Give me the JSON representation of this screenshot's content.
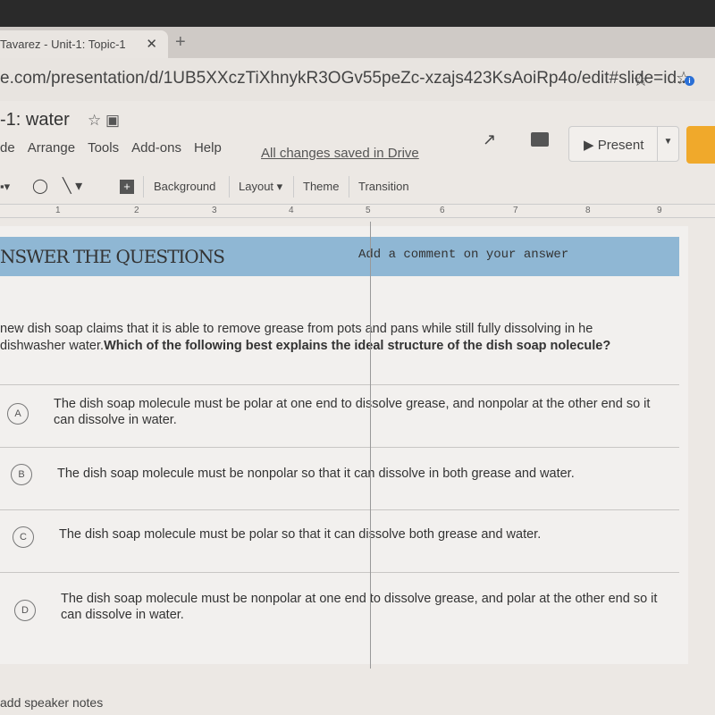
{
  "browser": {
    "tab_title": "Tavarez - Unit-1: Topic-1",
    "url": "e.com/presentation/d/1UB5XXczTiXhnykR3OGv55peZc-xzajs423KsAoiRp4o/edit#slide=id....",
    "ext_badge": "i"
  },
  "doc": {
    "title": "-1: water",
    "menu": [
      "de",
      "Arrange",
      "Tools",
      "Add-ons",
      "Help"
    ],
    "save_status": "All changes saved in Drive",
    "present_label": "Present"
  },
  "toolbar": {
    "background": "Background",
    "layout": "Layout ▾",
    "theme": "Theme",
    "transition": "Transition"
  },
  "ruler": [
    "1",
    "2",
    "3",
    "4",
    "5",
    "6",
    "7",
    "8",
    "9"
  ],
  "slide": {
    "heading": "NSWER THE QUESTIONS",
    "comment_hint": "Add a comment on your answer",
    "question_plain": "new dish soap claims that it is able to remove grease from pots and pans while still fully dissolving in he dishwasher water.",
    "question_bold": "Which of the following best explains the ideal structure of the dish soap nolecule?",
    "options": [
      {
        "letter": "A",
        "text": "The dish soap molecule must be polar at one end to dissolve grease, and nonpolar at the other end so it can dissolve in water."
      },
      {
        "letter": "B",
        "text": "The dish soap molecule must be nonpolar so that it can dissolve in both grease and water."
      },
      {
        "letter": "C",
        "text": "The dish soap molecule must be polar so that it can dissolve both grease and water."
      },
      {
        "letter": "D",
        "text": "The dish soap molecule must be nonpolar at one end to dissolve grease, and polar at the other end so it can dissolve in water."
      }
    ],
    "banner_color": "#8fb7d4"
  },
  "speaker_notes": "add speaker notes"
}
